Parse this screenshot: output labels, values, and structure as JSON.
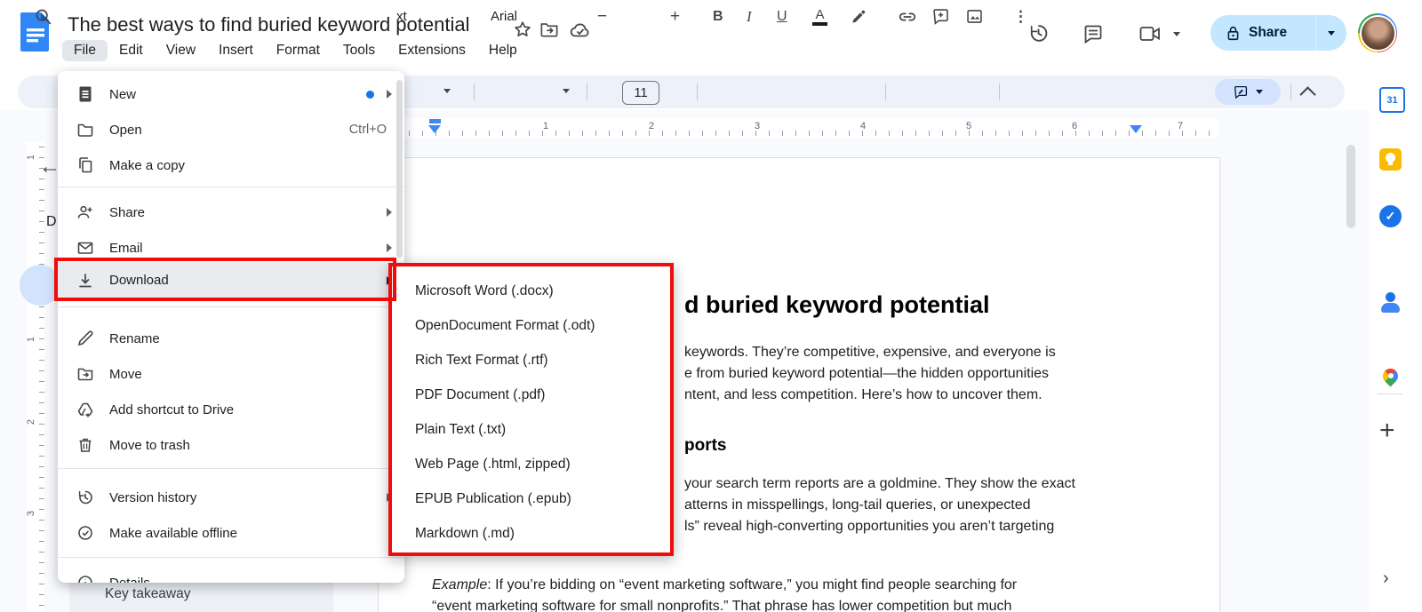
{
  "header": {
    "title": "The best ways to find buried keyword potential",
    "menus": [
      "File",
      "Edit",
      "View",
      "Insert",
      "Format",
      "Tools",
      "Extensions",
      "Help"
    ],
    "active_menu": "File",
    "share_label": "Share"
  },
  "toolbar": {
    "style_fragment": "xt",
    "font_name": "Arial",
    "font_size": "11",
    "minus": "−",
    "plus": "+",
    "bold": "B",
    "italic": "I",
    "underline": "U",
    "text_color": "A",
    "more": "⋮"
  },
  "file_menu": {
    "items": [
      {
        "label": "New"
      },
      {
        "label": "Open",
        "shortcut": "Ctrl+O"
      },
      {
        "label": "Make a copy"
      },
      {
        "label": "Share"
      },
      {
        "label": "Email"
      },
      {
        "label": "Download"
      },
      {
        "label": "Rename"
      },
      {
        "label": "Move"
      },
      {
        "label": "Add shortcut to Drive"
      },
      {
        "label": "Move to trash"
      },
      {
        "label": "Version history"
      },
      {
        "label": "Make available offline"
      },
      {
        "label": "Details"
      }
    ]
  },
  "download_submenu": {
    "items": [
      "Microsoft Word (.docx)",
      "OpenDocument Format (.odt)",
      "Rich Text Format (.rtf)",
      "PDF Document (.pdf)",
      "Plain Text (.txt)",
      "Web Page (.html, zipped)",
      "EPUB Publication (.epub)",
      "Markdown (.md)"
    ]
  },
  "ruler": {
    "h": [
      "1",
      "2",
      "3",
      "4",
      "5",
      "6",
      "7"
    ],
    "v": [
      "1",
      "1",
      "2",
      "3"
    ]
  },
  "outline": {
    "visible_letter": "D",
    "bottom_item": "Key takeaway"
  },
  "sidebar": {
    "calendar_label": "31",
    "tasks_check": "✓",
    "plus": "+",
    "chevron": "›"
  },
  "document": {
    "heading_fragment": "d buried keyword potential",
    "intro_lines": [
      "keywords. They’re competitive, expensive, and everyone is",
      "e from buried keyword potential—the hidden opportunities",
      "ntent, and less competition. Here’s how to uncover them."
    ],
    "section_heading_fragment": "ports",
    "section_lines": [
      "your search term reports are a goldmine. They show the exact",
      "atterns in misspellings, long-tail queries, or unexpected",
      "ls” reveal high-converting opportunities you aren’t targeting"
    ],
    "example_label": "Example",
    "example_rest": ": If you’re bidding on “event marketing software,” you might find people searching for",
    "example_line2": "“event marketing software for small nonprofits.” That phrase has lower competition but much"
  },
  "misc": {
    "back_arrow": "←"
  },
  "colors": {
    "annotation_red": "#f10c0c",
    "share_bg": "#c2e7ff",
    "toolbar_bg": "#edf2fa",
    "accent_blue": "#1a73e8",
    "canvas_bg": "#f8fafd"
  }
}
